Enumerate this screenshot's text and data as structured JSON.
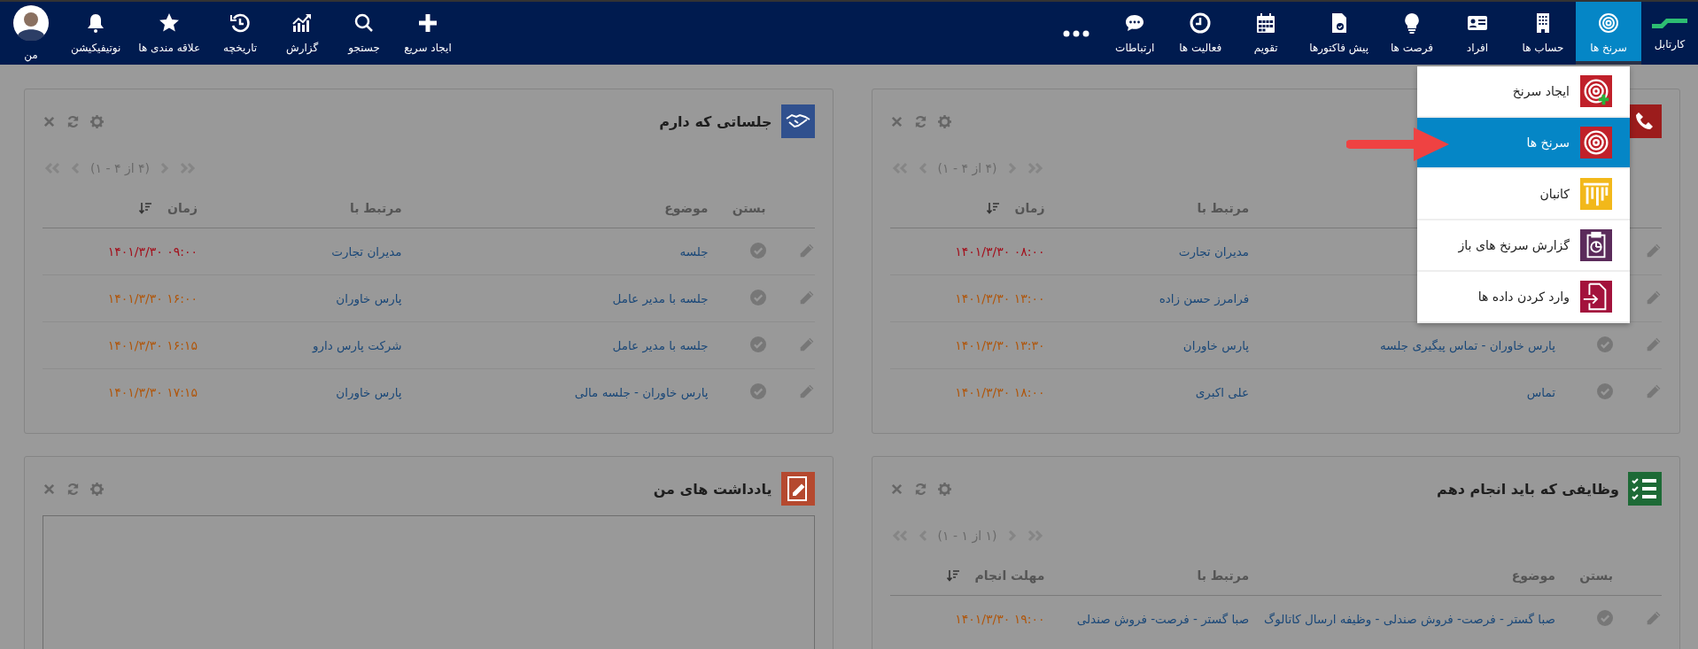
{
  "nav": {
    "logo_label": "کارتابل",
    "modules": [
      {
        "label": "سرنخ ها",
        "selected": true
      },
      {
        "label": "حساب ها",
        "selected": false
      },
      {
        "label": "افراد",
        "selected": false
      },
      {
        "label": "فرصت ها",
        "selected": false
      },
      {
        "label": "پیش فاکتورها",
        "selected": false
      },
      {
        "label": "تقویم",
        "selected": false
      },
      {
        "label": "فعالیت ها",
        "selected": false
      },
      {
        "label": "ارتباطات",
        "selected": false
      }
    ],
    "tools": [
      {
        "label": "ایجاد سریع"
      },
      {
        "label": "جستجو"
      },
      {
        "label": "گزارش"
      },
      {
        "label": "تاریخچه"
      },
      {
        "label": "علاقه مندی ها"
      },
      {
        "label": "نوتیفیکیشن"
      },
      {
        "label": "من"
      }
    ]
  },
  "dropdown": {
    "items": [
      {
        "label": "ایجاد سرنخ",
        "selected": false
      },
      {
        "label": "سرنخ ها",
        "selected": true
      },
      {
        "label": "کانبان",
        "selected": false
      },
      {
        "label": "گزارش سرنخ های باز",
        "selected": false
      },
      {
        "label": "وارد کردن داده ها",
        "selected": false
      }
    ]
  },
  "panels": [
    {
      "kind": "table",
      "pager": "(۴ از ۴ - ۱)",
      "columns": {
        "related": "مرتبط با",
        "time": "زمان"
      },
      "rows": [
        {
          "related": "مدیران تجارت",
          "time": "۱۴۰۱/۳/۳۰ ۰۸:۰۰",
          "color": "#a3101c"
        },
        {
          "related": "فرامرز حسن زاده",
          "time": "۱۴۰۱/۳/۳۰ ۱۳:۰۰",
          "color": "#b0560b"
        },
        {
          "subject": "پارس خاوران - تماس پیگیری جلسه",
          "related": "پارس خاوران",
          "time": "۱۴۰۱/۳/۳۰ ۱۳:۳۰",
          "color": "#b0560b"
        },
        {
          "subject": "تماس",
          "related": "علی اکبری",
          "time": "۱۴۰۱/۳/۳۰ ۱۸:۰۰",
          "color": "#b0560b"
        }
      ]
    },
    {
      "kind": "table",
      "title": "جلساتی که دارم",
      "pager": "(۴ از ۴ - ۱)",
      "columns": {
        "close": "بستن",
        "subject": "موضوع",
        "related": "مرتبط با",
        "time": "زمان"
      },
      "rows": [
        {
          "subject": "جلسه",
          "related": "مدیران تجارت",
          "time": "۱۴۰۱/۳/۳۰ ۰۹:۰۰",
          "color": "#a3101c"
        },
        {
          "subject": "جلسه با مدیر عامل",
          "related": "پارس خاوران",
          "time": "۱۴۰۱/۳/۳۰ ۱۶:۰۰",
          "color": "#b0560b"
        },
        {
          "subject": "جلسه با مدیر عامل",
          "related": "شرکت پارس دارو",
          "time": "۱۴۰۱/۳/۳۰ ۱۶:۱۵",
          "color": "#b0560b"
        },
        {
          "subject": "پارس خاوران - جلسه مالی",
          "related": "پارس خاوران",
          "time": "۱۴۰۱/۳/۳۰ ۱۷:۱۵",
          "color": "#b0560b"
        }
      ]
    },
    {
      "kind": "table",
      "title": "وظایفی که باید انجام دهم",
      "pager": "(۱ از ۱ - ۱)",
      "columns": {
        "close": "بستن",
        "subject": "موضوع",
        "related": "مرتبط با",
        "time": "مهلت انجام"
      },
      "rows": [
        {
          "subject": "صبا گستر - فرصت- فروش صندلی - وظیفه ارسال کاتالوگ",
          "related": "صبا گستر - فرصت- فروش صندلی",
          "time": "۱۴۰۱/۳/۳۰ ۱۹:۰۰",
          "color": "#b0560b"
        }
      ]
    },
    {
      "kind": "notes",
      "title": "یادداشت های من"
    }
  ]
}
